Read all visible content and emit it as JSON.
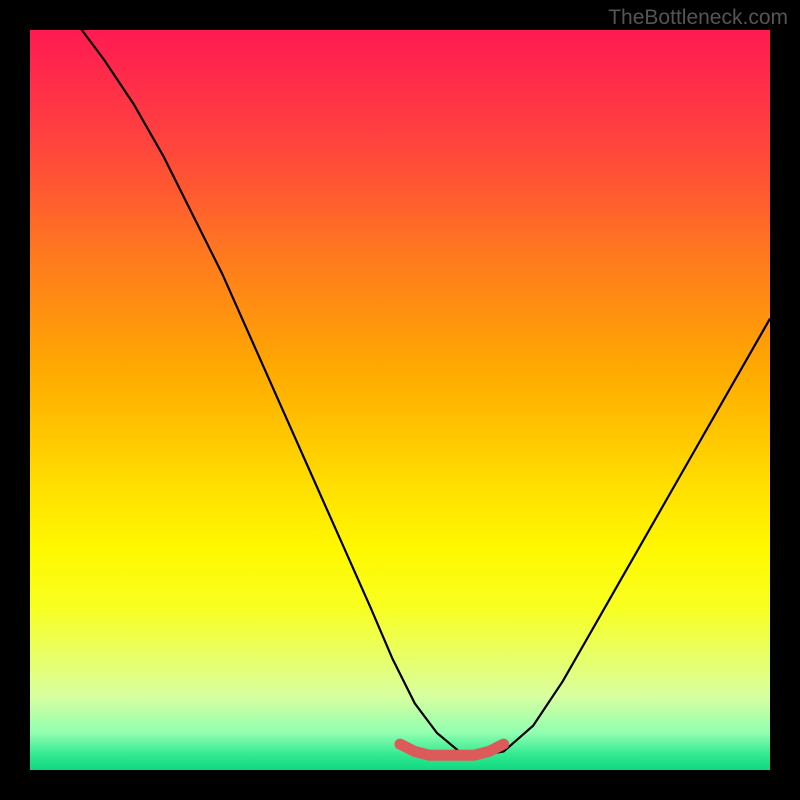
{
  "watermark": "TheBottleneck.com",
  "chart_data": {
    "type": "line",
    "title": "",
    "xlabel": "",
    "ylabel": "",
    "xlim": [
      0,
      100
    ],
    "ylim": [
      0,
      100
    ],
    "grid": false,
    "legend": false,
    "annotations": [],
    "gradient_stops": [
      {
        "pos": 0,
        "color": "#ff1a52"
      },
      {
        "pos": 14,
        "color": "#ff4040"
      },
      {
        "pos": 30,
        "color": "#ff7820"
      },
      {
        "pos": 46,
        "color": "#ffaa00"
      },
      {
        "pos": 62,
        "color": "#ffe000"
      },
      {
        "pos": 78,
        "color": "#f8ff20"
      },
      {
        "pos": 90,
        "color": "#d8ffa0"
      },
      {
        "pos": 98,
        "color": "#30e890"
      },
      {
        "pos": 100,
        "color": "#10d880"
      }
    ],
    "series": [
      {
        "name": "bottleneck-curve",
        "color": "#000000",
        "x": [
          7,
          10,
          14,
          18,
          22,
          26,
          30,
          34,
          38,
          42,
          46,
          49,
          52,
          55,
          58,
          61,
          64,
          68,
          72,
          76,
          80,
          84,
          88,
          92,
          96,
          100
        ],
        "y": [
          100,
          96,
          90,
          83,
          75,
          67,
          58,
          49,
          40,
          31,
          22,
          15,
          9,
          5,
          2.5,
          2,
          2.5,
          6,
          12,
          19,
          26,
          33,
          40,
          47,
          54,
          61
        ]
      },
      {
        "name": "highlight-band",
        "color": "#e06060",
        "x": [
          50,
          52,
          54,
          56,
          58,
          60,
          62,
          64
        ],
        "y": [
          3.5,
          2.5,
          2,
          2,
          2,
          2,
          2.5,
          3.5
        ]
      }
    ]
  }
}
